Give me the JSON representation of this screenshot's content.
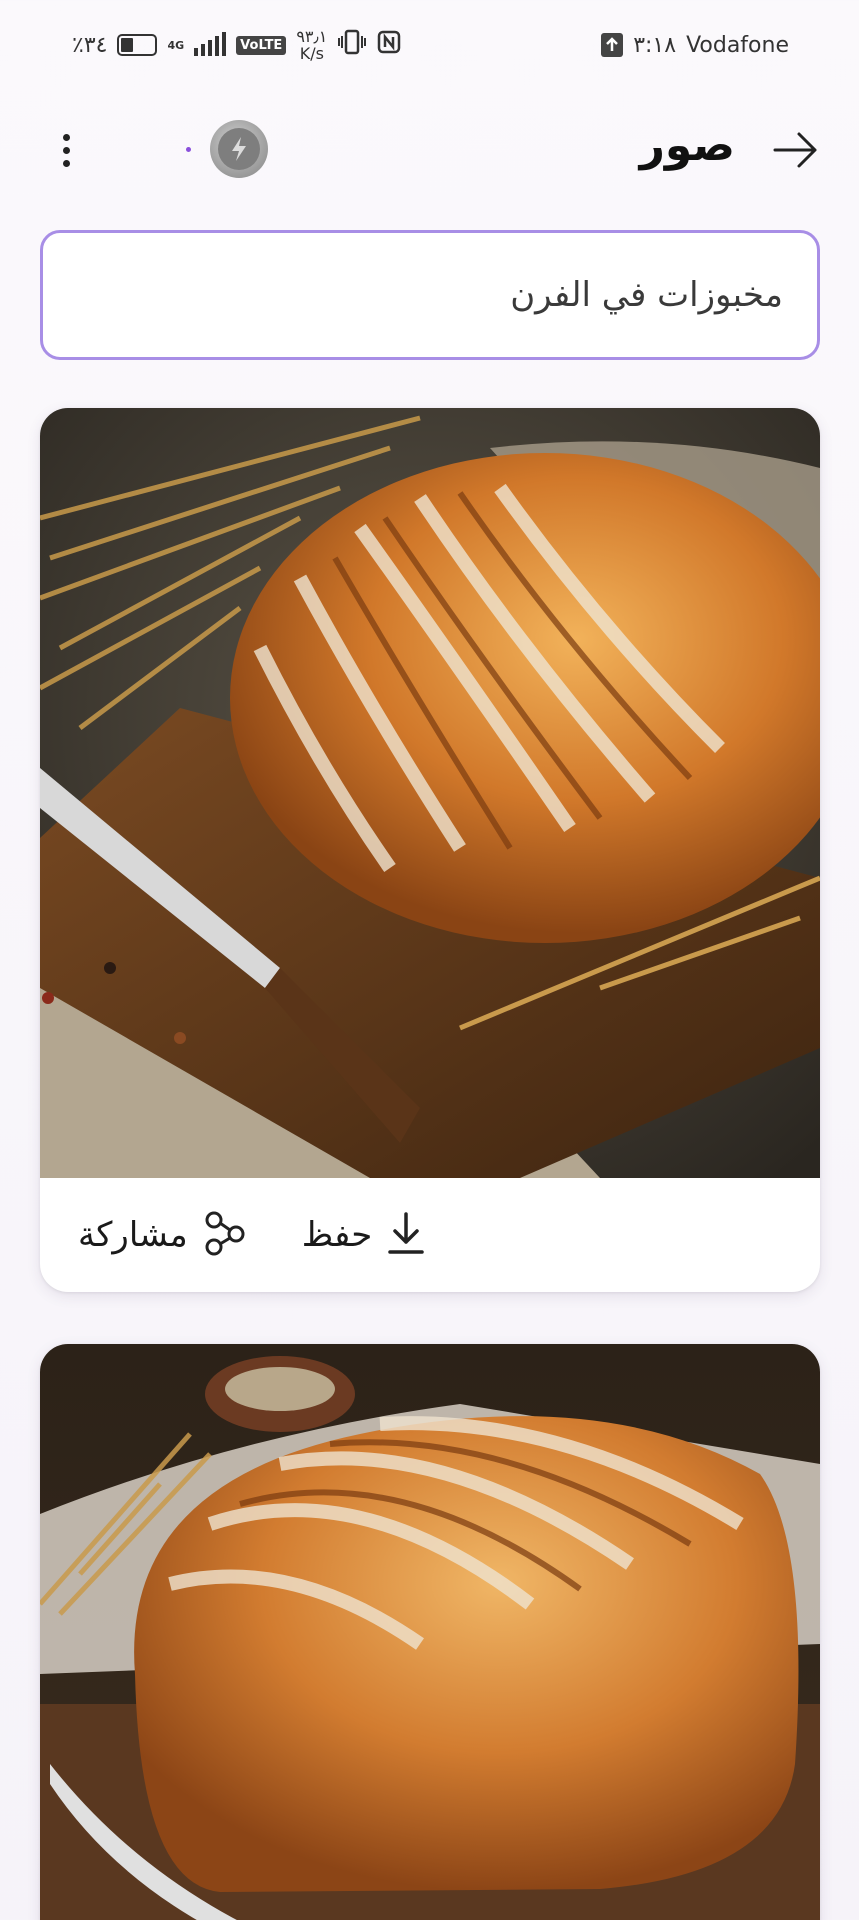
{
  "status_bar": {
    "battery": "٪٣٤",
    "network_gen": "4G",
    "volte": "VoLTE",
    "speed_value": "٩٣٫١",
    "speed_unit": "K/s",
    "time": "٣:١٨",
    "carrier": "Vodafone"
  },
  "header": {
    "title": "صور"
  },
  "prompt": {
    "text": "مخبوزات في الفرن"
  },
  "results": [
    {
      "image_icon": "bread-loaf-on-board-image",
      "actions": {
        "share": "مشاركة",
        "save": "حفظ"
      }
    },
    {
      "image_icon": "bread-loaf-image"
    }
  ],
  "colors": {
    "accent_border": "#a88ee6",
    "background": "#f8f6fa",
    "card": "#ffffff"
  }
}
